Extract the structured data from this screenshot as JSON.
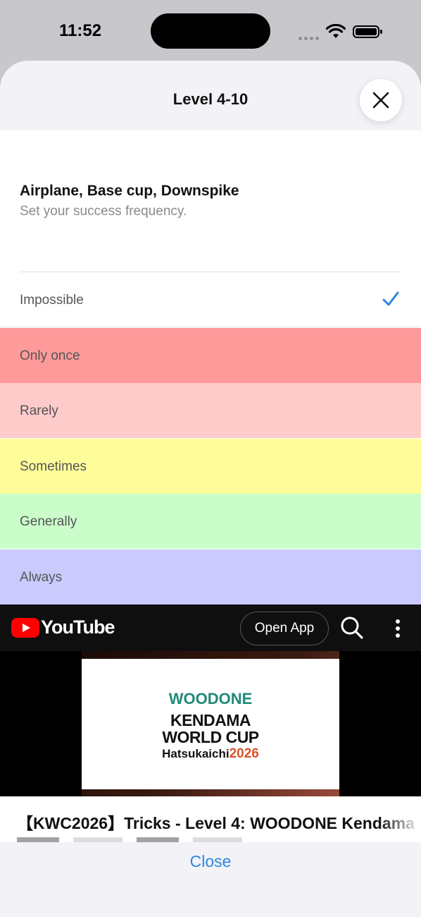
{
  "status_bar": {
    "time": "11:52"
  },
  "sheet": {
    "title": "Level 4-10"
  },
  "trick": {
    "name": "Airplane, Base cup, Downspike",
    "subtitle": "Set your success frequency."
  },
  "options": [
    {
      "label": "Impossible",
      "color": "#ffffff",
      "selected": true
    },
    {
      "label": "Only once",
      "color": "#fe9a9a",
      "selected": false
    },
    {
      "label": "Rarely",
      "color": "#fecbcb",
      "selected": false
    },
    {
      "label": "Sometimes",
      "color": "#fffd9a",
      "selected": false
    },
    {
      "label": "Generally",
      "color": "#cbfdcb",
      "selected": false
    },
    {
      "label": "Always",
      "color": "#cacafd",
      "selected": false
    }
  ],
  "youtube": {
    "brand": "YouTube",
    "open_app_label": "Open App",
    "thumbnail": {
      "brand": "WOODONE",
      "line1": "KENDAMA",
      "line2": "WORLD CUP",
      "place": "Hatsukaichi",
      "year": "2026"
    },
    "video_title": "【KWC2026】Tricks - Level 4: WOODONE Kendama"
  },
  "footer": {
    "close_label": "Close"
  },
  "colors": {
    "accent": "#2e86e0",
    "check": "#2e86e0",
    "youtube_red": "#ff0000"
  }
}
